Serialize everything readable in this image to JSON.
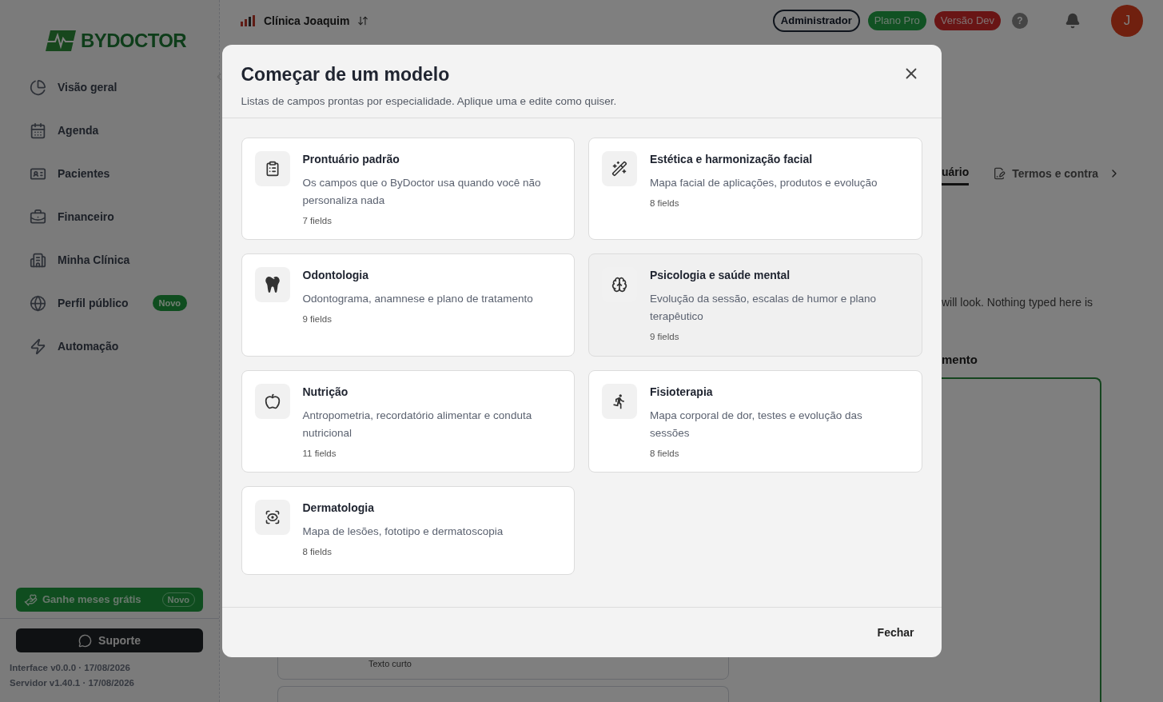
{
  "sidebar": {
    "brand": "BYDOCTOR",
    "items": [
      {
        "label": "Visão geral"
      },
      {
        "label": "Agenda"
      },
      {
        "label": "Pacientes"
      },
      {
        "label": "Financeiro"
      },
      {
        "label": "Minha Clínica"
      },
      {
        "label": "Perfil público",
        "badge": "Novo"
      },
      {
        "label": "Automação"
      }
    ],
    "promo": {
      "label": "Ganhe meses grátis",
      "badge": "Novo"
    },
    "support": "Suporte",
    "versions": [
      "Interface v0.0.0 · 17/08/2026",
      "Servidor v1.40.1 · 17/08/2026"
    ]
  },
  "header": {
    "clinic": "Clínica Joaquim",
    "badges": [
      {
        "label": "Administrador",
        "kind": "outline"
      },
      {
        "label": "Plano Pro",
        "kind": "green"
      },
      {
        "label": "Versão Dev",
        "kind": "red"
      }
    ],
    "help": "?",
    "avatar": "J"
  },
  "background": {
    "tabs": [
      {
        "label": "uário",
        "selected": true
      },
      {
        "label": "Termos e contra",
        "selected": false
      }
    ],
    "note": "will look. Nothing typed here is",
    "section": "mento",
    "field_type": "Texto curto"
  },
  "modal": {
    "title": "Começar de um modelo",
    "subtitle": "Listas de campos prontas por especialidade. Aplique uma e edite como quiser.",
    "templates": [
      {
        "name": "Prontuário padrão",
        "description": "Os campos que o ByDoctor usa quando você não personaliza nada",
        "count": "7 fields",
        "hovered": false
      },
      {
        "name": "Estética e harmonização facial",
        "description": "Mapa facial de aplicações, produtos e evolução",
        "count": "8 fields",
        "hovered": false
      },
      {
        "name": "Odontologia",
        "description": "Odontograma, anamnese e plano de tratamento",
        "count": "9 fields",
        "hovered": false
      },
      {
        "name": "Psicologia e saúde mental",
        "description": "Evolução da sessão, escalas de humor e plano terapêutico",
        "count": "9 fields",
        "hovered": true
      },
      {
        "name": "Nutrição",
        "description": "Antropometria, recordatório alimentar e conduta nutricional",
        "count": "11 fields",
        "hovered": false
      },
      {
        "name": "Fisioterapia",
        "description": "Mapa corporal de dor, testes e evolução das sessões",
        "count": "8 fields",
        "hovered": false
      },
      {
        "name": "Dermatologia",
        "description": "Mapa de lesões, fototipo e dermatoscopia",
        "count": "8 fields",
        "hovered": false
      }
    ],
    "close_button": "Fechar"
  }
}
